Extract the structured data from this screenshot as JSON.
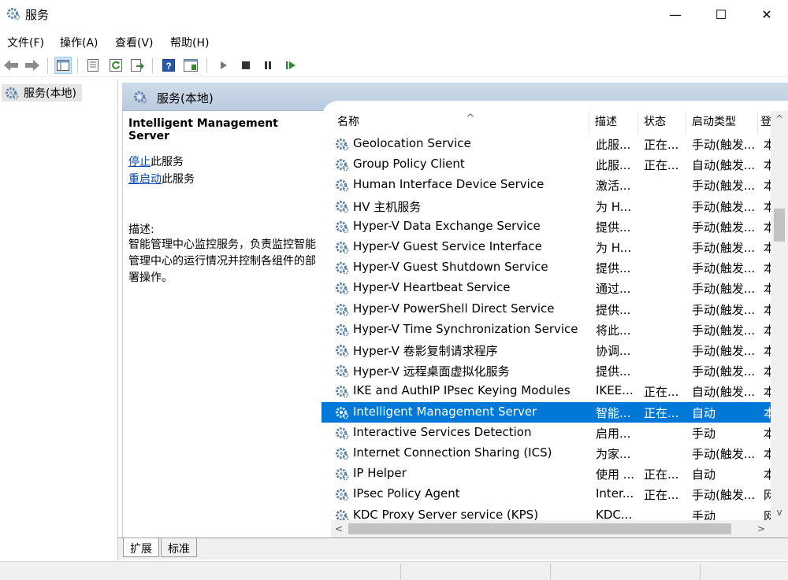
{
  "window": {
    "title": "服务",
    "minimize_glyph": "—",
    "maximize_glyph": "☐",
    "close_glyph": "✕"
  },
  "menu": [
    "文件(F)",
    "操作(A)",
    "查看(V)",
    "帮助(H)"
  ],
  "toolbar": {
    "icons": [
      "back-icon",
      "forward-icon",
      "show-tree-icon",
      "properties-icon",
      "refresh-icon",
      "export-list-icon",
      "help-icon",
      "console-icon",
      "start-service-icon",
      "stop-service-icon",
      "pause-service-icon",
      "restart-service-icon"
    ]
  },
  "tree": {
    "root_label": "服务(本地)"
  },
  "content": {
    "header_label": "服务(本地)"
  },
  "detail": {
    "service_name": "Intelligent Management Server",
    "stop_link": "停止",
    "stop_suffix": "此服务",
    "restart_link": "重启动",
    "restart_suffix": "此服务",
    "desc_label": "描述:",
    "description": "智能管理中心监控服务，负责监控智能管理中心的运行情况并控制各组件的部署操作。"
  },
  "list": {
    "columns": [
      "名称",
      "描述",
      "状态",
      "启动类型",
      "登"
    ],
    "sort_glyph": "^",
    "rows": [
      {
        "name": "Geolocation Service",
        "desc": "此服...",
        "status": "正在...",
        "startup": "手动(触发...",
        "login": "本"
      },
      {
        "name": "Group Policy Client",
        "desc": "此服...",
        "status": "正在...",
        "startup": "自动(触发...",
        "login": "本"
      },
      {
        "name": "Human Interface Device Service",
        "desc": "激活...",
        "status": "",
        "startup": "手动(触发...",
        "login": "本"
      },
      {
        "name": "HV 主机服务",
        "desc": "为 H...",
        "status": "",
        "startup": "手动(触发...",
        "login": "本"
      },
      {
        "name": "Hyper-V Data Exchange Service",
        "desc": "提供...",
        "status": "",
        "startup": "手动(触发...",
        "login": "本"
      },
      {
        "name": "Hyper-V Guest Service Interface",
        "desc": "为 H...",
        "status": "",
        "startup": "手动(触发...",
        "login": "本"
      },
      {
        "name": "Hyper-V Guest Shutdown Service",
        "desc": "提供...",
        "status": "",
        "startup": "手动(触发...",
        "login": "本"
      },
      {
        "name": "Hyper-V Heartbeat Service",
        "desc": "通过...",
        "status": "",
        "startup": "手动(触发...",
        "login": "本"
      },
      {
        "name": "Hyper-V PowerShell Direct Service",
        "desc": "提供...",
        "status": "",
        "startup": "手动(触发...",
        "login": "本"
      },
      {
        "name": "Hyper-V Time Synchronization Service",
        "desc": "将此...",
        "status": "",
        "startup": "手动(触发...",
        "login": "本"
      },
      {
        "name": "Hyper-V 卷影复制请求程序",
        "desc": "协调...",
        "status": "",
        "startup": "手动(触发...",
        "login": "本"
      },
      {
        "name": "Hyper-V 远程桌面虚拟化服务",
        "desc": "提供...",
        "status": "",
        "startup": "手动(触发...",
        "login": "本"
      },
      {
        "name": "IKE and AuthIP IPsec Keying Modules",
        "desc": "IKEE...",
        "status": "正在...",
        "startup": "自动(触发...",
        "login": "本"
      },
      {
        "name": "Intelligent Management Server",
        "desc": "智能...",
        "status": "正在...",
        "startup": "自动",
        "login": "本",
        "selected": true
      },
      {
        "name": "Interactive Services Detection",
        "desc": "启用...",
        "status": "",
        "startup": "手动",
        "login": "本"
      },
      {
        "name": "Internet Connection Sharing (ICS)",
        "desc": "为家...",
        "status": "",
        "startup": "手动(触发...",
        "login": "本"
      },
      {
        "name": "IP Helper",
        "desc": "使用 ...",
        "status": "正在...",
        "startup": "自动",
        "login": "本"
      },
      {
        "name": "IPsec Policy Agent",
        "desc": "Inter...",
        "status": "正在...",
        "startup": "手动(触发...",
        "login": "网"
      },
      {
        "name": "KDC Proxy Server service (KPS)",
        "desc": "KDC...",
        "status": "",
        "startup": "手动",
        "login": "网"
      }
    ]
  },
  "scroll": {
    "up": "^",
    "down": "v",
    "left": "<",
    "right": ">"
  },
  "tabs": [
    "扩展",
    "标准"
  ],
  "colors": {
    "selection": "#0078d7",
    "header_gradient_top": "#cfdbe8",
    "link": "#0645ad"
  }
}
